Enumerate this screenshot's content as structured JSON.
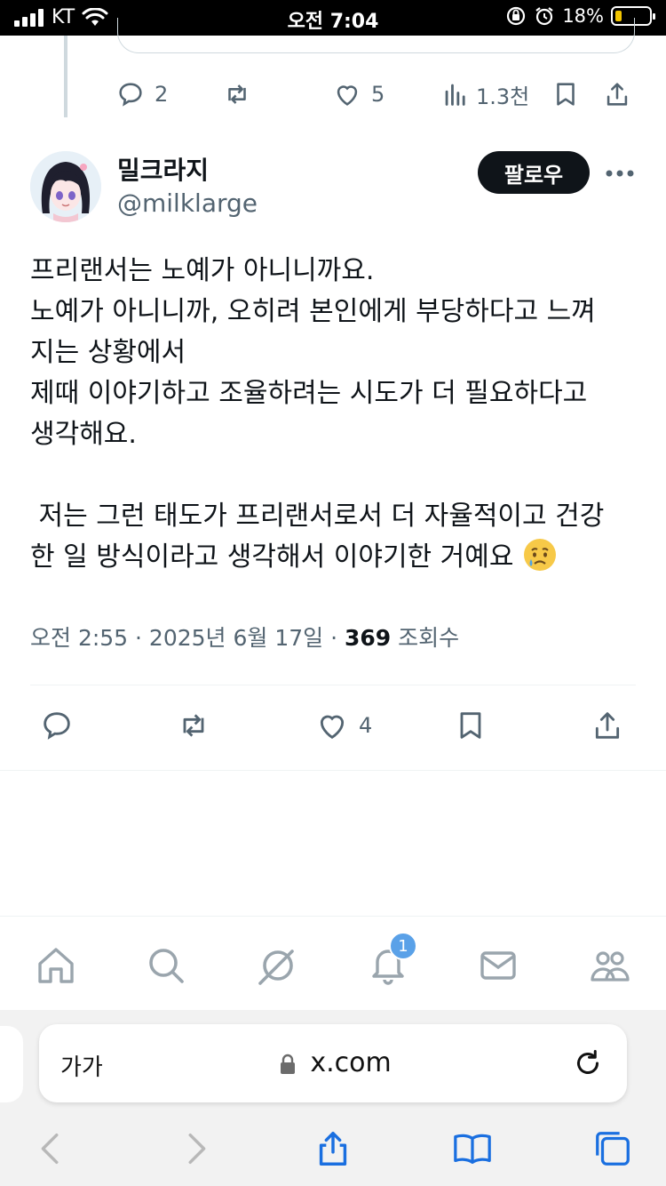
{
  "status_bar": {
    "carrier": "KT",
    "time": "오전 7:04",
    "battery_percent": "18%"
  },
  "previous_tweet": {
    "reply_count": "2",
    "like_count": "5",
    "views_count": "1.3천"
  },
  "tweet": {
    "author_name": "밀크라지",
    "author_handle": "@milklarge",
    "follow_label": "팔로우",
    "lines": [
      "프리랜서는 노예가 아니니까요.",
      "노예가 아니니까, 오히려 본인에게 부당하다고 느껴",
      "지는 상황에서",
      "제때 이야기하고 조율하려는 시도가 더 필요하다고",
      "생각해요.",
      "",
      " 저는 그런 태도가 프리랜서로서 더 자율적이고 건강",
      "한 일 방식이라고 생각해서 이야기한 거예요"
    ],
    "timestamp": "오전 2:55 · 2025년 6월 17일 · ",
    "views_number": "369",
    "views_label": " 조회수",
    "like_count": "4"
  },
  "tab_bar": {
    "notification_badge": "1",
    "items": [
      "home-icon",
      "search-icon",
      "grok-icon",
      "notifications-icon",
      "messages-icon",
      "communities-icon"
    ]
  },
  "safari": {
    "text_size_label": "가가",
    "domain": "x.com"
  },
  "colors": {
    "text_primary": "#0f1419",
    "text_secondary": "#536471",
    "safari_blue": "#1a6fe0",
    "badge_blue": "#5aa1e8"
  }
}
